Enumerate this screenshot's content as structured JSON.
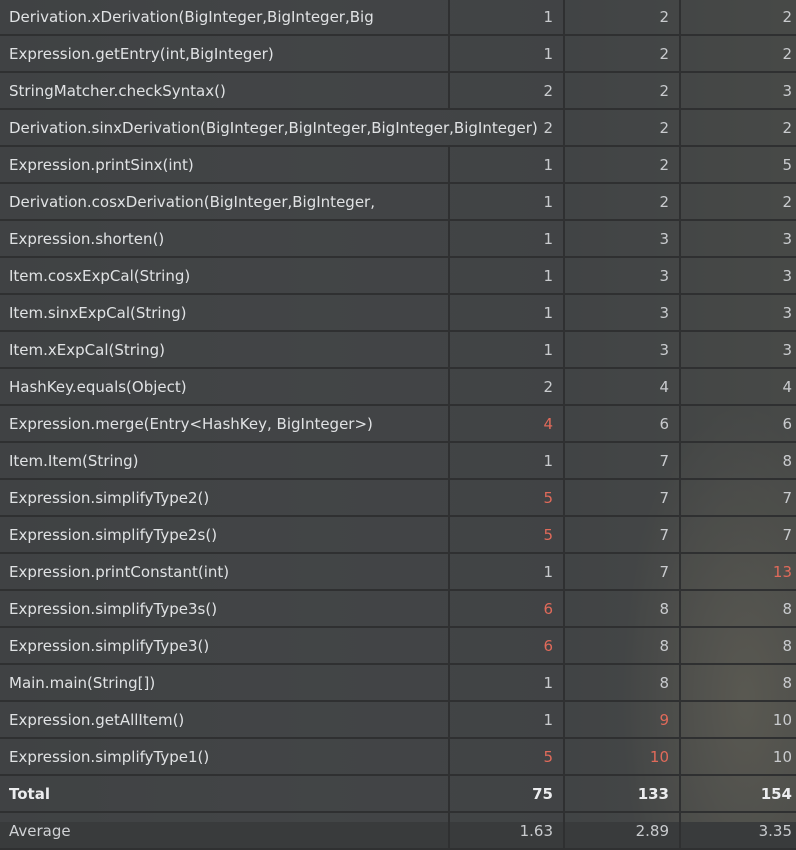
{
  "colors": {
    "highlight": "#e06a5a",
    "text": "#d8dadd",
    "cell_bg": "#454749"
  },
  "rows": [
    {
      "name": "Derivation.xDerivation(BigInteger,BigInteger,Big",
      "c1": "1",
      "c2": "2",
      "c3": "2"
    },
    {
      "name": "Expression.getEntry(int,BigInteger)",
      "c1": "1",
      "c2": "2",
      "c3": "2"
    },
    {
      "name": "StringMatcher.checkSyntax()",
      "c1": "2",
      "c2": "2",
      "c3": "3"
    },
    {
      "name": "Derivation.sinxDerivation(BigInteger,BigInteger,BigInteger,BigInteger)",
      "c1": "2",
      "c2": "2",
      "c3": "2"
    },
    {
      "name": "Expression.printSinx(int)",
      "c1": "1",
      "c2": "2",
      "c3": "5"
    },
    {
      "name": "Derivation.cosxDerivation(BigInteger,BigInteger,",
      "c1": "1",
      "c2": "2",
      "c3": "2"
    },
    {
      "name": "Expression.shorten()",
      "c1": "1",
      "c2": "3",
      "c3": "3"
    },
    {
      "name": "Item.cosxExpCal(String)",
      "c1": "1",
      "c2": "3",
      "c3": "3"
    },
    {
      "name": "Item.sinxExpCal(String)",
      "c1": "1",
      "c2": "3",
      "c3": "3"
    },
    {
      "name": "Item.xExpCal(String)",
      "c1": "1",
      "c2": "3",
      "c3": "3"
    },
    {
      "name": "HashKey.equals(Object)",
      "c1": "2",
      "c2": "4",
      "c3": "4"
    },
    {
      "name": "Expression.merge(Entry<HashKey, BigInteger>)",
      "c1": "4",
      "c2": "6",
      "c3": "6"
    },
    {
      "name": "Item.Item(String)",
      "c1": "1",
      "c2": "7",
      "c3": "8"
    },
    {
      "name": "Expression.simplifyType2()",
      "c1": "5",
      "c2": "7",
      "c3": "7"
    },
    {
      "name": "Expression.simplifyType2s()",
      "c1": "5",
      "c2": "7",
      "c3": "7"
    },
    {
      "name": "Expression.printConstant(int)",
      "c1": "1",
      "c2": "7",
      "c3": "13"
    },
    {
      "name": "Expression.simplifyType3s()",
      "c1": "6",
      "c2": "8",
      "c3": "8"
    },
    {
      "name": "Expression.simplifyType3()",
      "c1": "6",
      "c2": "8",
      "c3": "8"
    },
    {
      "name": "Main.main(String[])",
      "c1": "1",
      "c2": "8",
      "c3": "8"
    },
    {
      "name": "Expression.getAllItem()",
      "c1": "1",
      "c2": "9",
      "c3": "10"
    },
    {
      "name": "Expression.simplifyType1()",
      "c1": "5",
      "c2": "10",
      "c3": "10"
    }
  ],
  "total": {
    "name": "Total",
    "c1": "75",
    "c2": "133",
    "c3": "154"
  },
  "average": {
    "name": "Average",
    "c1": "1.63",
    "c2": "2.89",
    "c3": "3.35"
  }
}
